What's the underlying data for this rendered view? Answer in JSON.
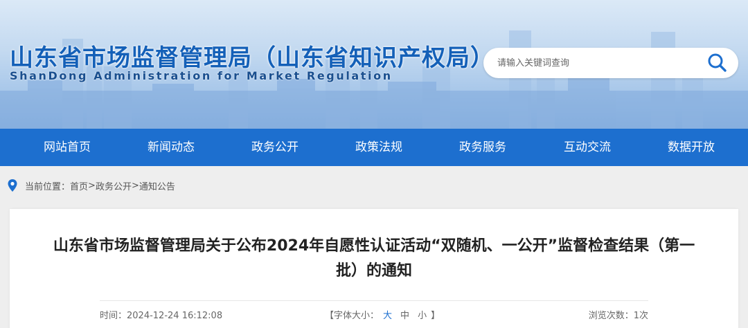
{
  "header": {
    "title": "山东省市场监督管理局（山东省知识产权局）",
    "subtitle": "ShanDong Administration for Market Regulation"
  },
  "search": {
    "placeholder": "请输入关键词查询",
    "icon": "search-icon"
  },
  "nav": {
    "items": [
      {
        "label": "网站首页"
      },
      {
        "label": "新闻动态"
      },
      {
        "label": "政务公开"
      },
      {
        "label": "政策法规"
      },
      {
        "label": "政务服务"
      },
      {
        "label": "互动交流"
      },
      {
        "label": "数据开放"
      }
    ]
  },
  "breadcrumb": {
    "icon": "location-pin-icon",
    "prefix": "当前位置：",
    "items": [
      "首页",
      "政务公开",
      "通知公告"
    ],
    "separator": ">"
  },
  "article": {
    "title": "山东省市场监督管理局关于公布2024年自愿性认证活动“双随机、一公开”监督检查结果（第一批）的通知",
    "time_label": "时间：",
    "time_value": "2024-12-24 16:12:08",
    "font_bracket_open": "【",
    "font_size_label": "字体大小：",
    "font_large": "大",
    "font_medium": "中",
    "font_small": "小",
    "font_bracket_close": "】",
    "views_label": "浏览次数：",
    "views_value": "1次"
  },
  "colors": {
    "brand_blue": "#1d6fcf",
    "title_blue": "#1460b8"
  }
}
